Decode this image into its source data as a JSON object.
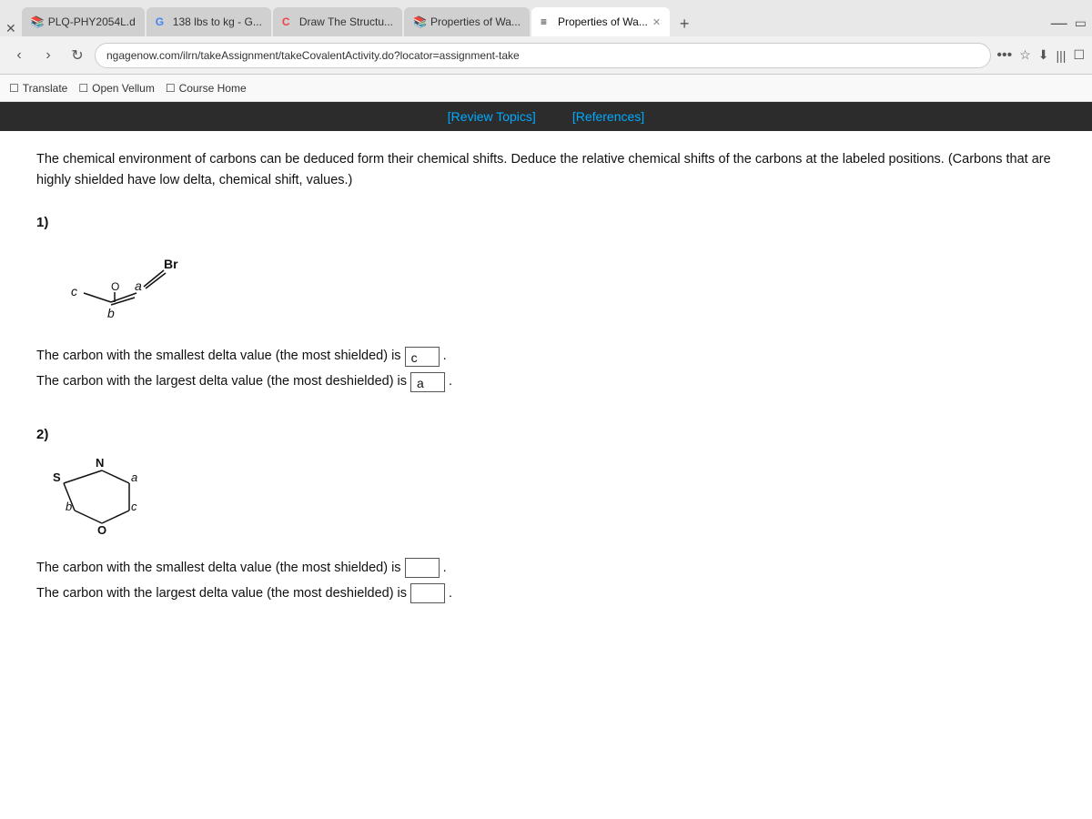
{
  "browser": {
    "tabs": [
      {
        "id": "tab-plq",
        "favicon": "📚",
        "label": "PLQ-PHY2054L.d",
        "active": false
      },
      {
        "id": "tab-google",
        "favicon": "G",
        "label": "138 lbs to kg - G...",
        "active": false
      },
      {
        "id": "tab-draw",
        "favicon": "C",
        "label": "Draw The Structu...",
        "active": false
      },
      {
        "id": "tab-prop1",
        "favicon": "📚",
        "label": "Properties of Wa...",
        "active": false
      },
      {
        "id": "tab-prop2",
        "favicon": "≡",
        "label": "Properties of Wa...",
        "active": true
      }
    ],
    "address": "ngagenow.com/ilrn/takeAssignment/takeCovalentActivity.do?locator=assignment-take",
    "bookmarks": [
      "Translate",
      "Open Vellum",
      "Course Home"
    ]
  },
  "page": {
    "toolbar_links": [
      "[Review Topics]",
      "[References]"
    ],
    "intro": "The chemical environment of carbons can be deduced form their chemical shifts. Deduce the relative chemical shifts of the carbons at the labeled positions. (Carbons that are highly shielded have low delta, chemical shift, values.)",
    "questions": [
      {
        "number": "1)",
        "molecule_label": "molecule-1-bromoalkene",
        "atoms": [
          "c",
          "b",
          "a",
          "Br"
        ],
        "q1_text": "The carbon with the smallest delta value (the most shielded) is",
        "q1_answer": "c",
        "q1_filled": true,
        "q2_text": "The carbon with the largest delta value (the most deshielded) is",
        "q2_answer": "a",
        "q2_filled": true
      },
      {
        "number": "2)",
        "molecule_label": "molecule-2-morpholine",
        "atoms": [
          "N",
          "b",
          "a",
          "S",
          "O",
          "c"
        ],
        "q1_text": "The carbon with the smallest delta value (the most shielded) is",
        "q1_answer": "",
        "q1_filled": false,
        "q2_text": "The carbon with the largest delta value (the most deshielded) is",
        "q2_answer": "",
        "q2_filled": false
      }
    ]
  }
}
